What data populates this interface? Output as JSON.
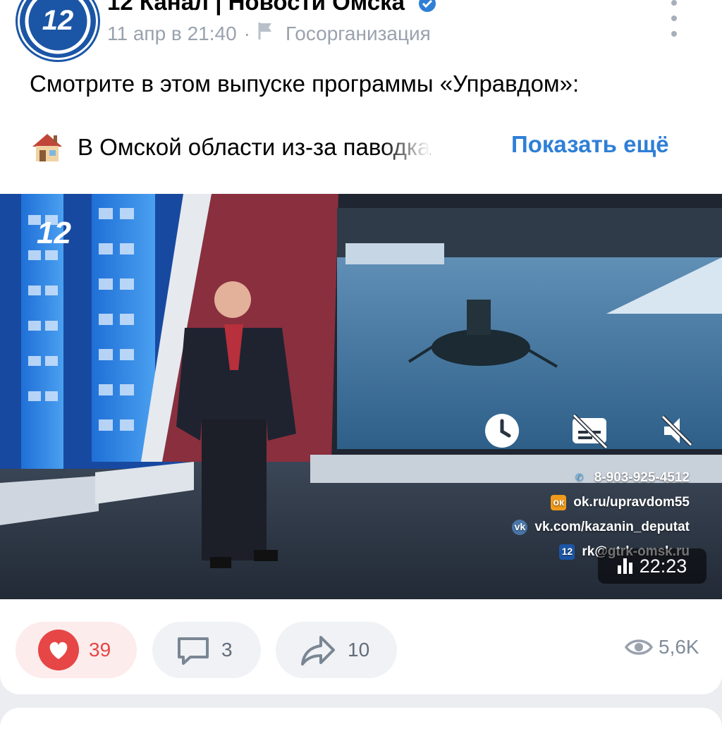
{
  "post": {
    "author_name": "12 Канал | Новости Омска",
    "date": "11 апр в 21:40",
    "separator": "·",
    "author_type": "Госорганизация",
    "text_line1": "Смотрите в этом выпуске программы «Управдом»:",
    "text_line2": "В Омской области из-за паводка",
    "show_more_label": "Показать ещё"
  },
  "video": {
    "duration": "22:23",
    "contacts": [
      {
        "icon": "phone-icon",
        "text": "8-903-925-4512"
      },
      {
        "icon": "ok-icon",
        "text": "ok.ru/upravdom55"
      },
      {
        "icon": "vk-icon",
        "text": "vk.com/kazanin_deputat"
      },
      {
        "icon": "channel12-icon",
        "text": "rk@gtrk-omsk.ru"
      }
    ],
    "overlay_icons": [
      "clock-icon",
      "subtitles-off-icon",
      "mute-icon"
    ]
  },
  "actions": {
    "likes": "39",
    "comments": "3",
    "shares": "10",
    "views": "5,6K"
  },
  "colors": {
    "accent": "#2f7fd6",
    "like": "#e64646",
    "muted": "#99a2ad"
  }
}
